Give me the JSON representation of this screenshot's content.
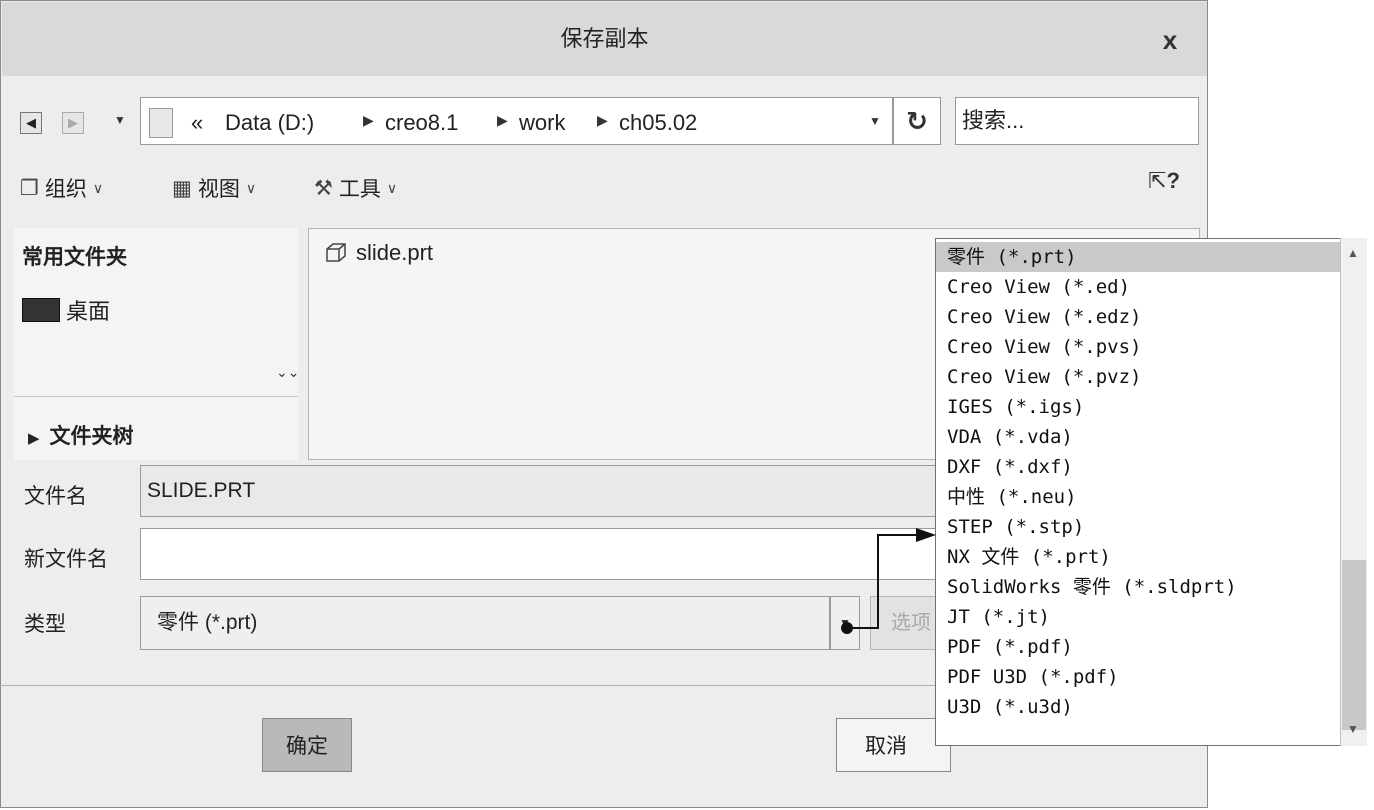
{
  "dialog": {
    "title": "保存副本",
    "close_label": "x"
  },
  "nav": {
    "back_icon": "arrow-left-icon",
    "forward_icon": "arrow-right-icon",
    "history_icon": "chevron-down-icon",
    "breadcrumbs": [
      "Data (D:)",
      "creo8.1",
      "work",
      "ch05.02"
    ],
    "prefix": "«",
    "search_placeholder": "搜索..."
  },
  "toolbar": {
    "organize_label": "组织",
    "view_label": "视图",
    "tools_label": "工具",
    "help_label": "?"
  },
  "left_pane": {
    "favorites_title": "常用文件夹",
    "desktop_label": "桌面",
    "folder_tree_label": "文件夹树"
  },
  "files": [
    {
      "name": "slide.prt"
    }
  ],
  "form": {
    "filename_label": "文件名",
    "filename_value": "SLIDE.PRT",
    "new_filename_label": "新文件名",
    "new_filename_value": "",
    "type_label": "类型",
    "type_value": "零件 (*.prt)",
    "options_label": "选项"
  },
  "buttons": {
    "ok": "确定",
    "cancel": "取消"
  },
  "type_options": [
    "零件 (*.prt)",
    "Creo View (*.ed)",
    "Creo View (*.edz)",
    "Creo View (*.pvs)",
    "Creo View (*.pvz)",
    "IGES (*.igs)",
    "VDA (*.vda)",
    "DXF (*.dxf)",
    "中性 (*.neu)",
    "STEP (*.stp)",
    "NX 文件 (*.prt)",
    "SolidWorks 零件 (*.sldprt)",
    "JT (*.jt)",
    "PDF (*.pdf)",
    "PDF U3D (*.pdf)",
    "U3D (*.u3d)"
  ],
  "selected_option_index": 0
}
